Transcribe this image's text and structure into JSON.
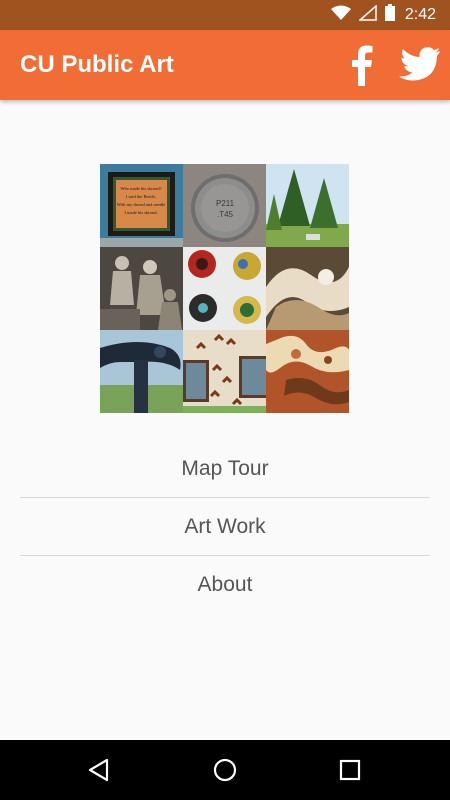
{
  "status_bar": {
    "time": "2:42",
    "icons": [
      "wifi-icon",
      "signal-icon",
      "battery-icon"
    ],
    "color": "#a0521f"
  },
  "app_bar": {
    "title": "CU Public Art",
    "color": "#f26d36",
    "actions": [
      "facebook-icon",
      "twitter-icon"
    ]
  },
  "collage": {
    "tiles": [
      {
        "name": "framed-poem-artwork",
        "poem_lines": [
          "Who made his shroud?",
          "I said the Beetle,",
          "With my thread and needle",
          "I made his shroud."
        ]
      },
      {
        "name": "metal-plaque-artwork",
        "text_lines": [
          "P211",
          ".T45"
        ]
      },
      {
        "name": "trees-artwork"
      },
      {
        "name": "figures-sculpture-artwork"
      },
      {
        "name": "ceramic-plates-artwork"
      },
      {
        "name": "abstract-painting-artwork"
      },
      {
        "name": "dark-sculpture-artwork"
      },
      {
        "name": "building-wall-artwork"
      },
      {
        "name": "cutout-metal-artwork"
      }
    ]
  },
  "menu": {
    "items": [
      {
        "label": "Map Tour"
      },
      {
        "label": "Art Work"
      },
      {
        "label": "About"
      }
    ]
  },
  "nav_bar": {
    "buttons": [
      "back-icon",
      "home-icon",
      "recents-icon"
    ]
  }
}
